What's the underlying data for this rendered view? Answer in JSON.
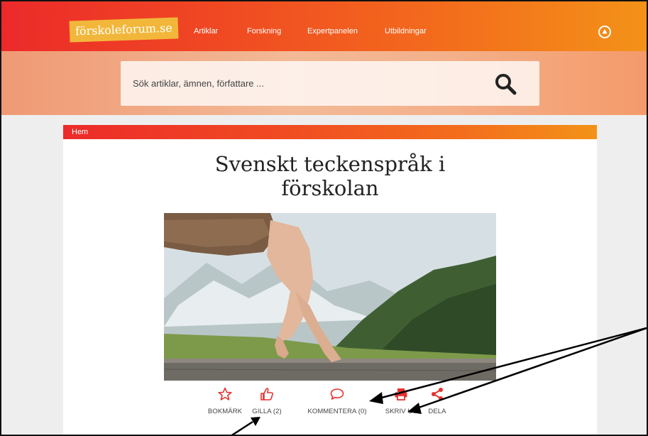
{
  "header": {
    "logo": "förskoleforum.se",
    "nav": [
      {
        "label": "Artiklar"
      },
      {
        "label": "Forskning"
      },
      {
        "label": "Expertpanelen"
      },
      {
        "label": "Utbildningar"
      }
    ],
    "user_icon": "user-circle-icon"
  },
  "search": {
    "placeholder": "Sök artiklar, ämnen, författare ...",
    "icon": "search-icon"
  },
  "breadcrumb": {
    "home": "Hem"
  },
  "article": {
    "title_line1": "Svenskt teckenspråk i",
    "title_line2": "förskolan",
    "image_alt": "hand walking with two fingers on a wooden rail, mountains behind"
  },
  "actions": [
    {
      "label": "BOKMÄRK",
      "icon": "star-icon"
    },
    {
      "label": "GILLA (2)",
      "icon": "thumbs-up-icon"
    },
    {
      "label": "KOMMENTERA (0)",
      "icon": "comment-icon"
    },
    {
      "label": "SKRIV UT",
      "icon": "print-icon"
    },
    {
      "label": "DELA",
      "icon": "share-icon"
    }
  ],
  "colors": {
    "accent_red": "#e8302f",
    "brand_orange": "#f36e1c",
    "logo_yellow": "#f2b73a"
  }
}
